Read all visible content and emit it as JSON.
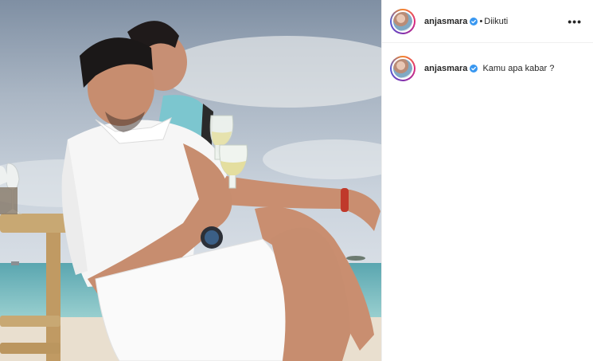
{
  "header": {
    "username": "anjasmara",
    "separator": "•",
    "follow_state": "Diikuti",
    "more_label": "•••"
  },
  "caption": {
    "username": "anjasmara",
    "text": "Kamu apa kabar ?"
  },
  "colors": {
    "verified": "#3897f0",
    "text": "#262626",
    "border": "#efefef"
  },
  "icons": {
    "verified": "verified-badge-icon",
    "more": "more-options-icon"
  }
}
